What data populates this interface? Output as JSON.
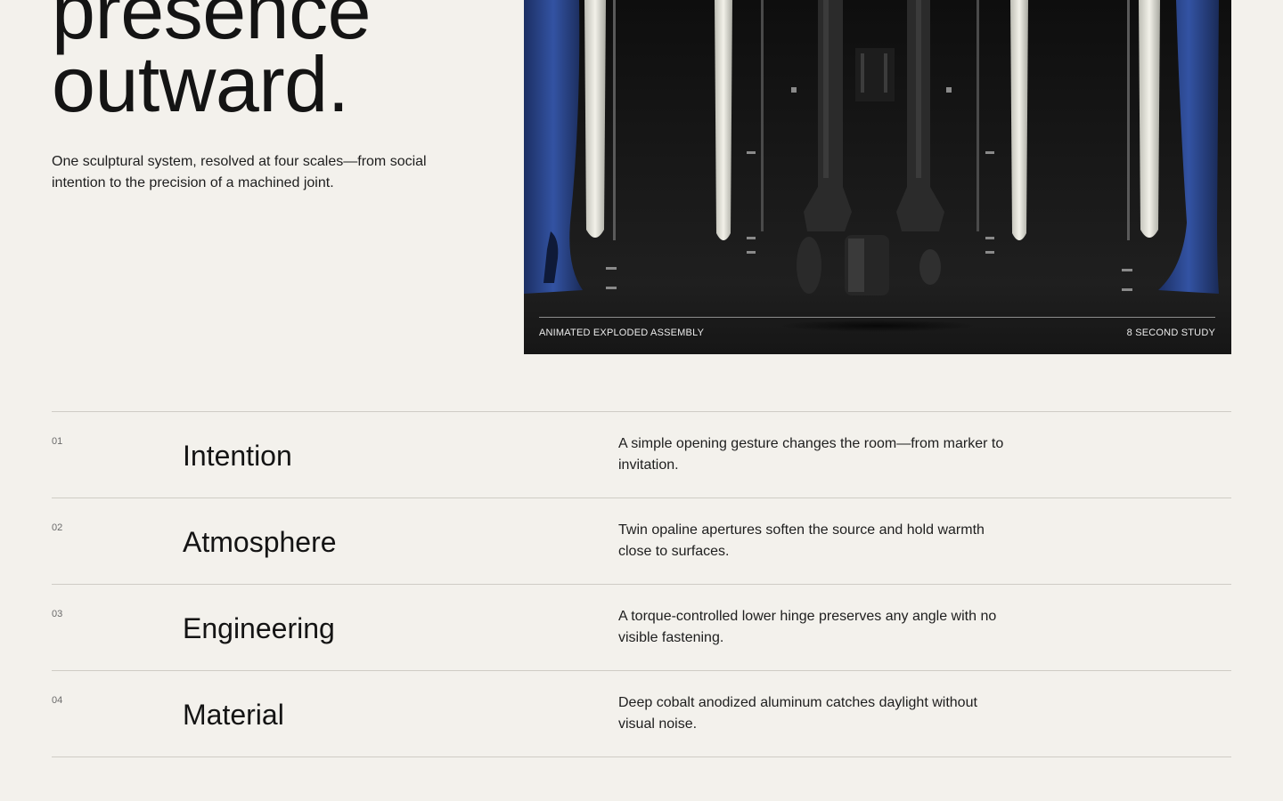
{
  "hero": {
    "title_line1": "presence",
    "title_line2": "outward.",
    "subtitle": "One sculptural system, resolved at four scales—from social intention to the precision of a machined joint."
  },
  "media": {
    "caption_left": "ANIMATED EXPLODED ASSEMBLY",
    "caption_right": "8 SECOND STUDY"
  },
  "features": [
    {
      "num": "01",
      "name": "Intention",
      "desc": "A simple opening gesture changes the room—from marker to invitation."
    },
    {
      "num": "02",
      "name": "Atmosphere",
      "desc": "Twin opaline apertures soften the source and hold warmth close to surfaces."
    },
    {
      "num": "03",
      "name": "Engineering",
      "desc": "A torque-controlled lower hinge preserves any angle with no visible fastening."
    },
    {
      "num": "04",
      "name": "Material",
      "desc": "Deep cobalt anodized aluminum catches daylight without visual noise."
    }
  ],
  "colors": {
    "background": "#f3f1ec",
    "cobalt": "#2b4589",
    "dark": "#141414"
  }
}
